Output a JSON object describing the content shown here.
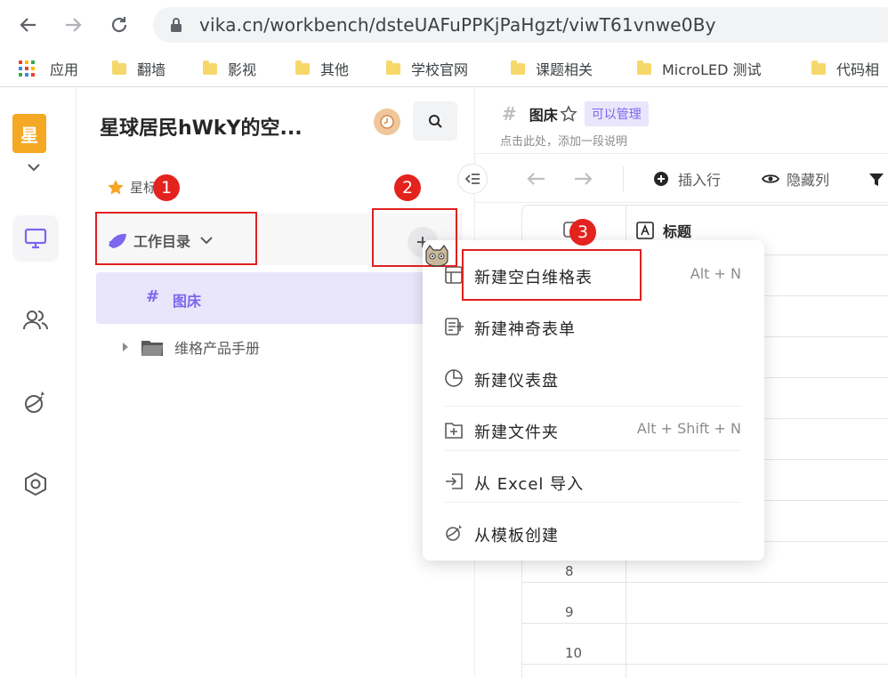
{
  "browser": {
    "url": "vika.cn/workbench/dsteUAFuPPKjPaHgzt/viwT61vnwe0By",
    "bookmarks": [
      {
        "label": "应用"
      },
      {
        "label": "翻墙"
      },
      {
        "label": "影视"
      },
      {
        "label": "其他"
      },
      {
        "label": "学校官网"
      },
      {
        "label": "课题相关"
      },
      {
        "label": "MicroLED 测试"
      },
      {
        "label": "代码相"
      }
    ]
  },
  "rail": {
    "space_badge": "星"
  },
  "tree": {
    "space_name": "星球居民hWkY的空...",
    "starred_label": "星标",
    "workdir_label": "工作目录",
    "nodes": {
      "active": "图床",
      "folder": "维格产品手册"
    }
  },
  "sheet": {
    "title": "图床",
    "permission": "可以管理",
    "description": "点击此处，添加一段说明",
    "toolbar": {
      "insert_row": "插入行",
      "hide_column": "隐藏列"
    },
    "column_title": "标题",
    "row_numbers": [
      "8",
      "9",
      "10"
    ]
  },
  "menu": {
    "items": [
      {
        "label": "新建空白维格表",
        "shortcut": "Alt + N"
      },
      {
        "label": "新建神奇表单",
        "shortcut": ""
      },
      {
        "label": "新建仪表盘",
        "shortcut": ""
      },
      {
        "label": "新建文件夹",
        "shortcut": "Alt + Shift + N"
      },
      {
        "label": "从 Excel 导入",
        "shortcut": ""
      },
      {
        "label": "从模板创建",
        "shortcut": ""
      }
    ]
  },
  "annotations": {
    "step1": "1",
    "step2": "2",
    "step3": "3"
  },
  "colors": {
    "accent": "#7b67ee",
    "annotation_red": "#e02020",
    "space_badge": "#f4a823"
  }
}
